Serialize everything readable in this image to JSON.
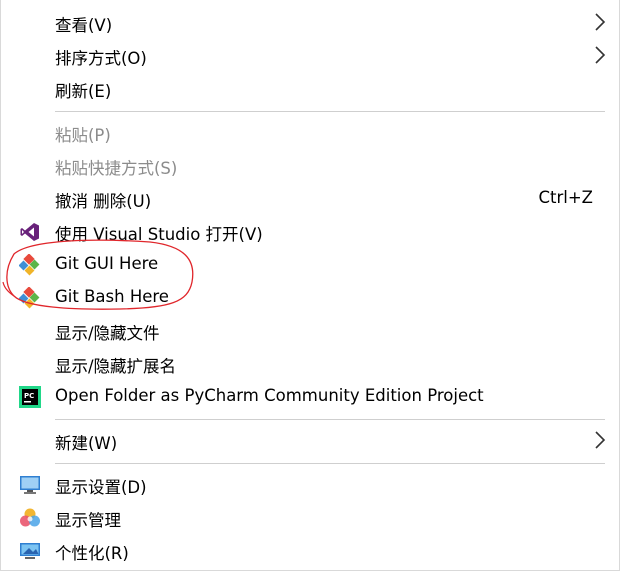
{
  "menu": {
    "items": [
      {
        "label": "查看(V)"
      },
      {
        "label": "排序方式(O)"
      },
      {
        "label": "刷新(E)"
      },
      {
        "label": "粘贴(P)"
      },
      {
        "label": "粘贴快捷方式(S)"
      },
      {
        "label": "撤消 删除(U)",
        "shortcut": "Ctrl+Z"
      },
      {
        "label": "使用 Visual Studio 打开(V)",
        "icon": "visual-studio-icon"
      },
      {
        "label": "Git GUI Here",
        "icon": "git-icon"
      },
      {
        "label": "Git Bash Here",
        "icon": "git-icon"
      },
      {
        "label": "显示/隐藏文件"
      },
      {
        "label": "显示/隐藏扩展名"
      },
      {
        "label": "Open Folder as PyCharm Community Edition Project",
        "icon": "pycharm-icon"
      },
      {
        "label": "新建(W)"
      },
      {
        "label": "显示设置(D)",
        "icon": "display-settings-icon"
      },
      {
        "label": "显示管理",
        "icon": "display-manager-icon"
      },
      {
        "label": "个性化(R)",
        "icon": "personalize-icon"
      }
    ]
  },
  "colors": {
    "disabled_text": "#8c8c8c",
    "separator": "#cfcfcf",
    "annotation": "#e0262b"
  }
}
